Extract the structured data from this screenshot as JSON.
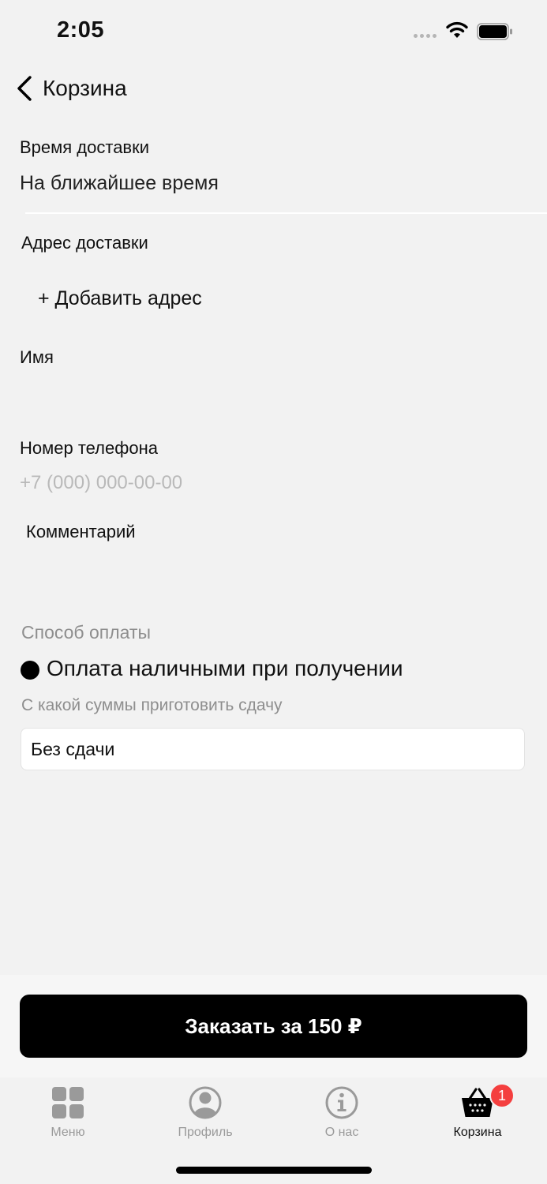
{
  "status_bar": {
    "time": "2:05"
  },
  "nav": {
    "title": "Корзина"
  },
  "delivery_time": {
    "label": "Время доставки",
    "value": "На ближайшее время"
  },
  "address": {
    "label": "Адрес доставки",
    "add_label": "+ Добавить адрес"
  },
  "name": {
    "label": "Имя"
  },
  "phone": {
    "label": "Номер телефона",
    "placeholder": "+7 (000) 000-00-00"
  },
  "comment": {
    "label": "Комментарий"
  },
  "payment": {
    "label": "Способ оплаты",
    "method": "Оплата наличными при получении",
    "change_label": "С какой суммы приготовить сдачу",
    "change_value": "Без сдачи"
  },
  "order_button": {
    "label": "Заказать за 150 ₽"
  },
  "tabbar": {
    "items": [
      {
        "label": "Меню",
        "icon": "grid-icon"
      },
      {
        "label": "Профиль",
        "icon": "profile-icon"
      },
      {
        "label": "О нас",
        "icon": "info-icon"
      },
      {
        "label": "Корзина",
        "icon": "basket-icon"
      }
    ],
    "cart_badge": "1"
  },
  "colors": {
    "accent": "#000000",
    "badge": "#f43f3f",
    "background": "#f2f2f2",
    "muted": "#8e8e8e"
  }
}
